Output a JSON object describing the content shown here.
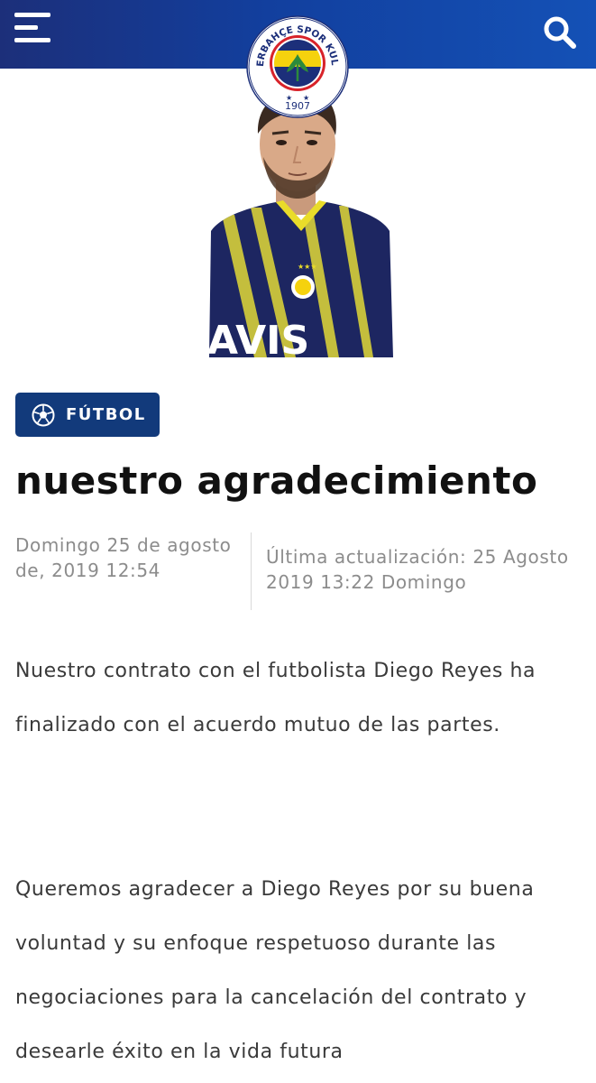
{
  "header": {
    "menu_icon": "hamburger-menu-icon",
    "search_icon": "search-icon",
    "logo": {
      "name": "fenerbahce-crest",
      "ring_text": "FENERBAHÇE SPOR KULÜBÜ",
      "year": "1907",
      "colors": {
        "navy": "#1c2f7a",
        "yellow": "#f5d20e",
        "red": "#d8232a",
        "green": "#2c8a3c"
      }
    }
  },
  "article": {
    "category": "FÚTBOL",
    "category_icon": "soccer-ball-icon",
    "title": "nuestro agradecimiento",
    "published": "Domingo 25 de agosto de, 2019 12:54",
    "updated": "Última actualización: 25 Agosto 2019 13:22 Domingo",
    "paragraphs": [
      "Nuestro contrato con el futbolista Diego Reyes ha finalizado con el acuerdo mutuo de las partes.",
      "Queremos agradecer a Diego Reyes por su buena voluntad y su enfoque respetuoso durante las negociaciones para la cancelación del contrato y desearle éxito en la vida futura"
    ],
    "image": {
      "name": "player-photo",
      "shirt_text": "AVIS"
    }
  },
  "colors": {
    "header_bg": "#123f9e",
    "pill_bg": "#123a7b",
    "meta_text": "#8c8c8c",
    "body_text": "#3a3a3a"
  }
}
